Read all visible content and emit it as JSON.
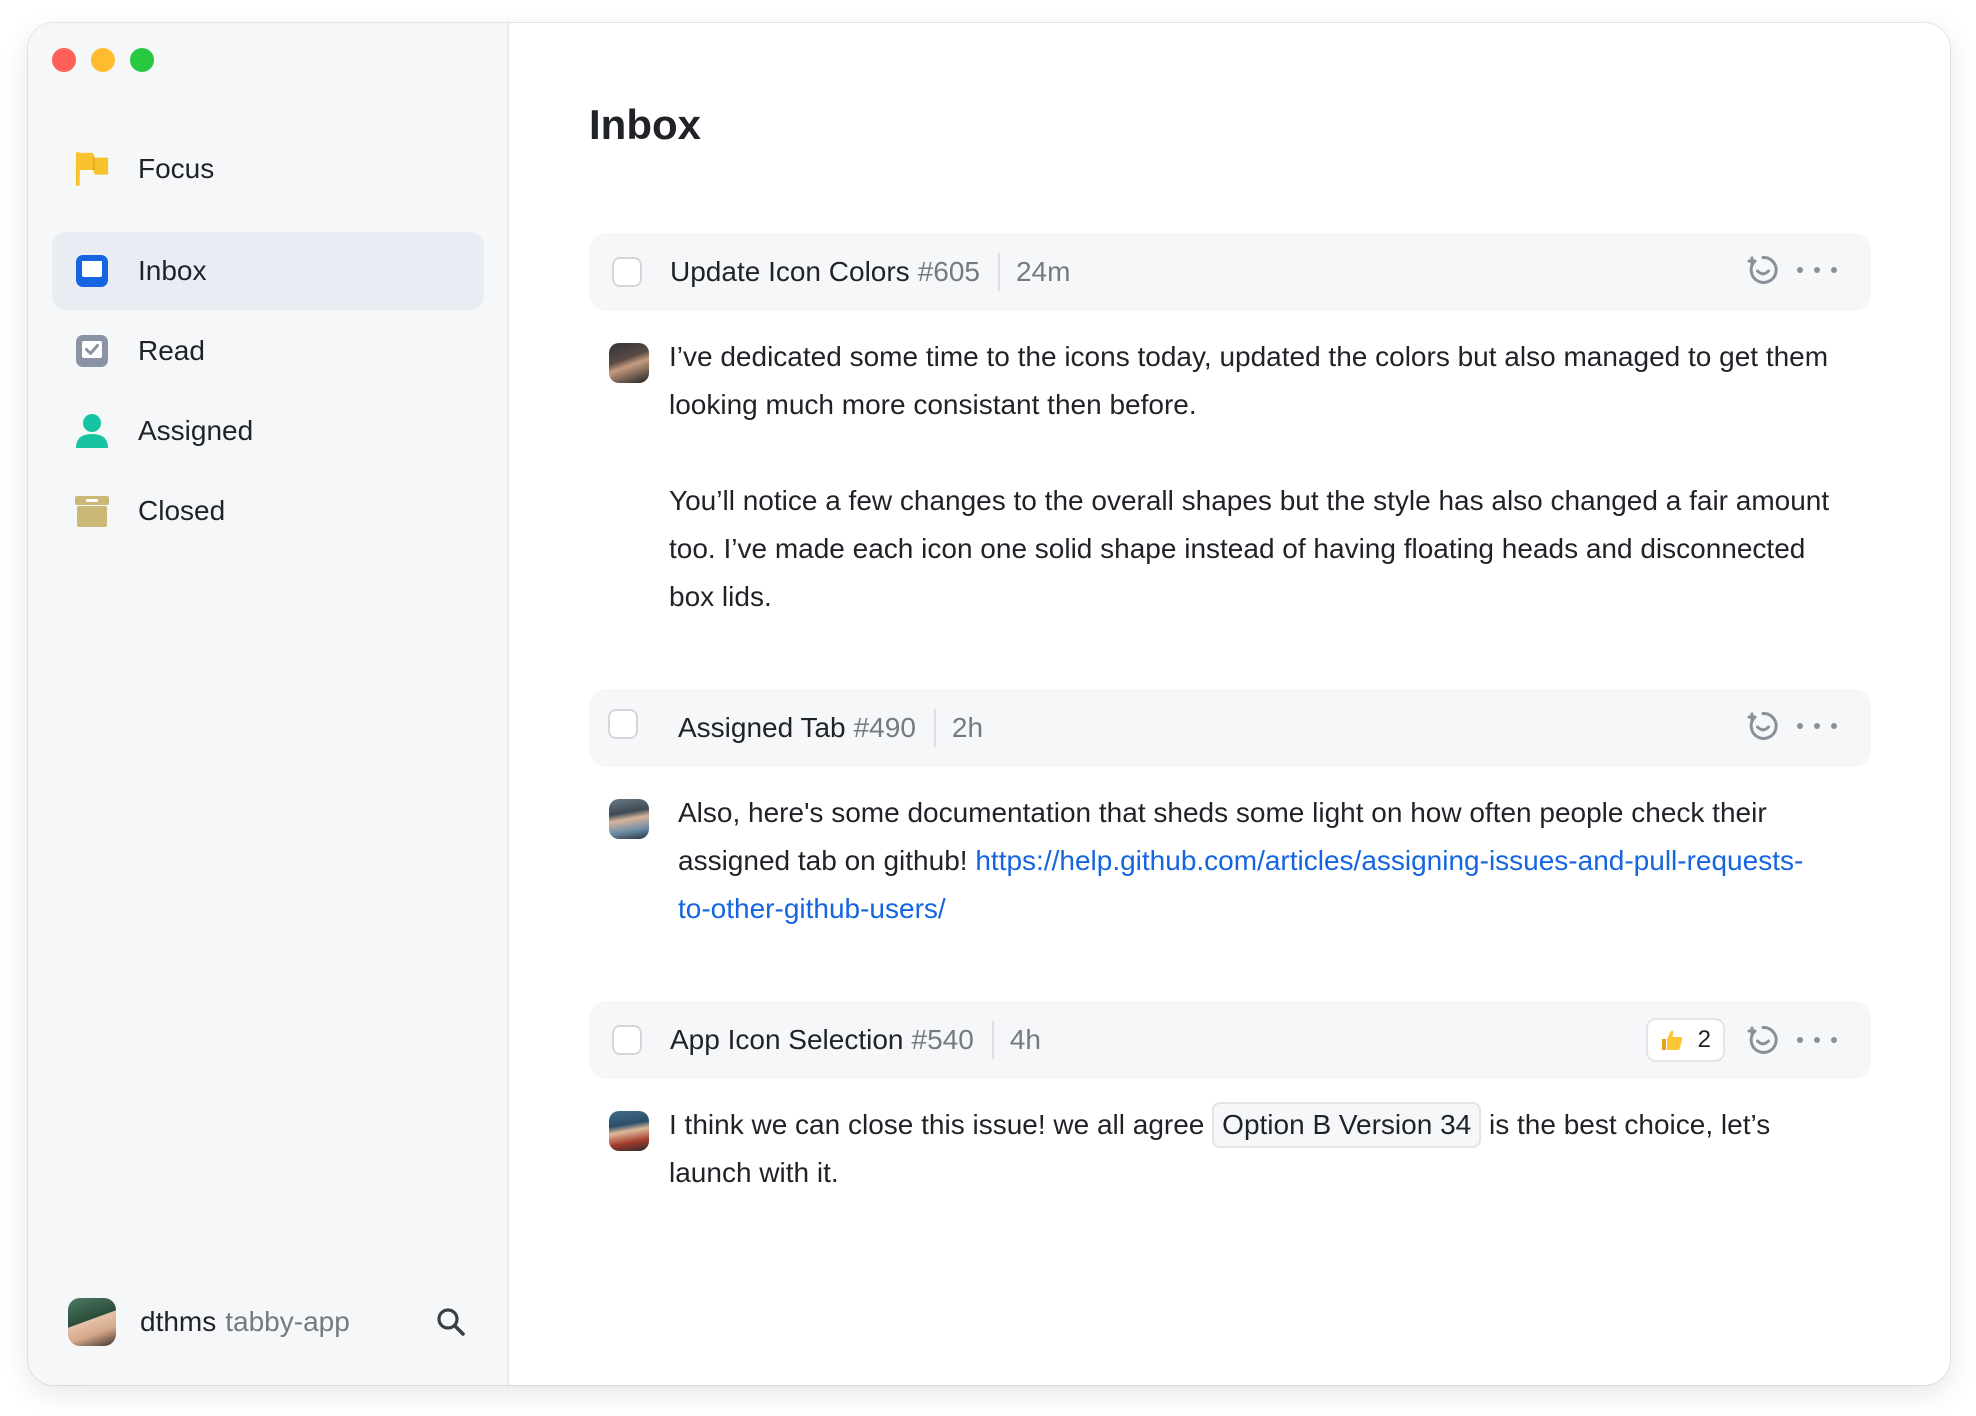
{
  "sidebar": {
    "focus": {
      "label": "Focus",
      "icon": "flag-icon"
    },
    "items": [
      {
        "label": "Inbox",
        "icon": "inbox-icon",
        "active": true
      },
      {
        "label": "Read",
        "icon": "read-check-icon",
        "active": false
      },
      {
        "label": "Assigned",
        "icon": "person-icon",
        "active": false
      },
      {
        "label": "Closed",
        "icon": "archive-box-icon",
        "active": false
      }
    ],
    "footer": {
      "user": "dthms",
      "org": "tabby-app"
    }
  },
  "main": {
    "title": "Inbox",
    "threads": [
      {
        "title": "Update Icon Colors",
        "number": "#605",
        "time": "24m",
        "paragraphs": [
          "I’ve dedicated some time to the icons today, updated the colors but also managed to get them looking much more consistant then before.",
          "You’ll notice a few changes to the overall shapes but the style has also changed a fair amount too. I’ve made each icon one solid shape instead of having floating heads and disconnected box lids."
        ]
      },
      {
        "title": "Assigned Tab",
        "number": "#490",
        "time": "2h",
        "text_before_link": "Also, here's some documentation that sheds some light on how often people check their assigned tab on github!",
        "link": "https://help.github.com/articles/assigning-issues-and-pull-requests-to-other-github-users/"
      },
      {
        "title": "App Icon Selection",
        "number": "#540",
        "time": "4h",
        "reaction": {
          "emoji": "thumbs-up",
          "count": "2"
        },
        "text_before_code": "I think we can close this issue! we all agree",
        "code": "Option B Version 34",
        "text_after_code": "is the best choice, let’s launch with it."
      }
    ]
  },
  "colors": {
    "accent_blue": "#1565e0",
    "focus_flag": "#f7c22b",
    "assigned_teal": "#16c4a2",
    "closed_box": "#cbb776",
    "sidebar_bg": "#f6f7f9"
  }
}
